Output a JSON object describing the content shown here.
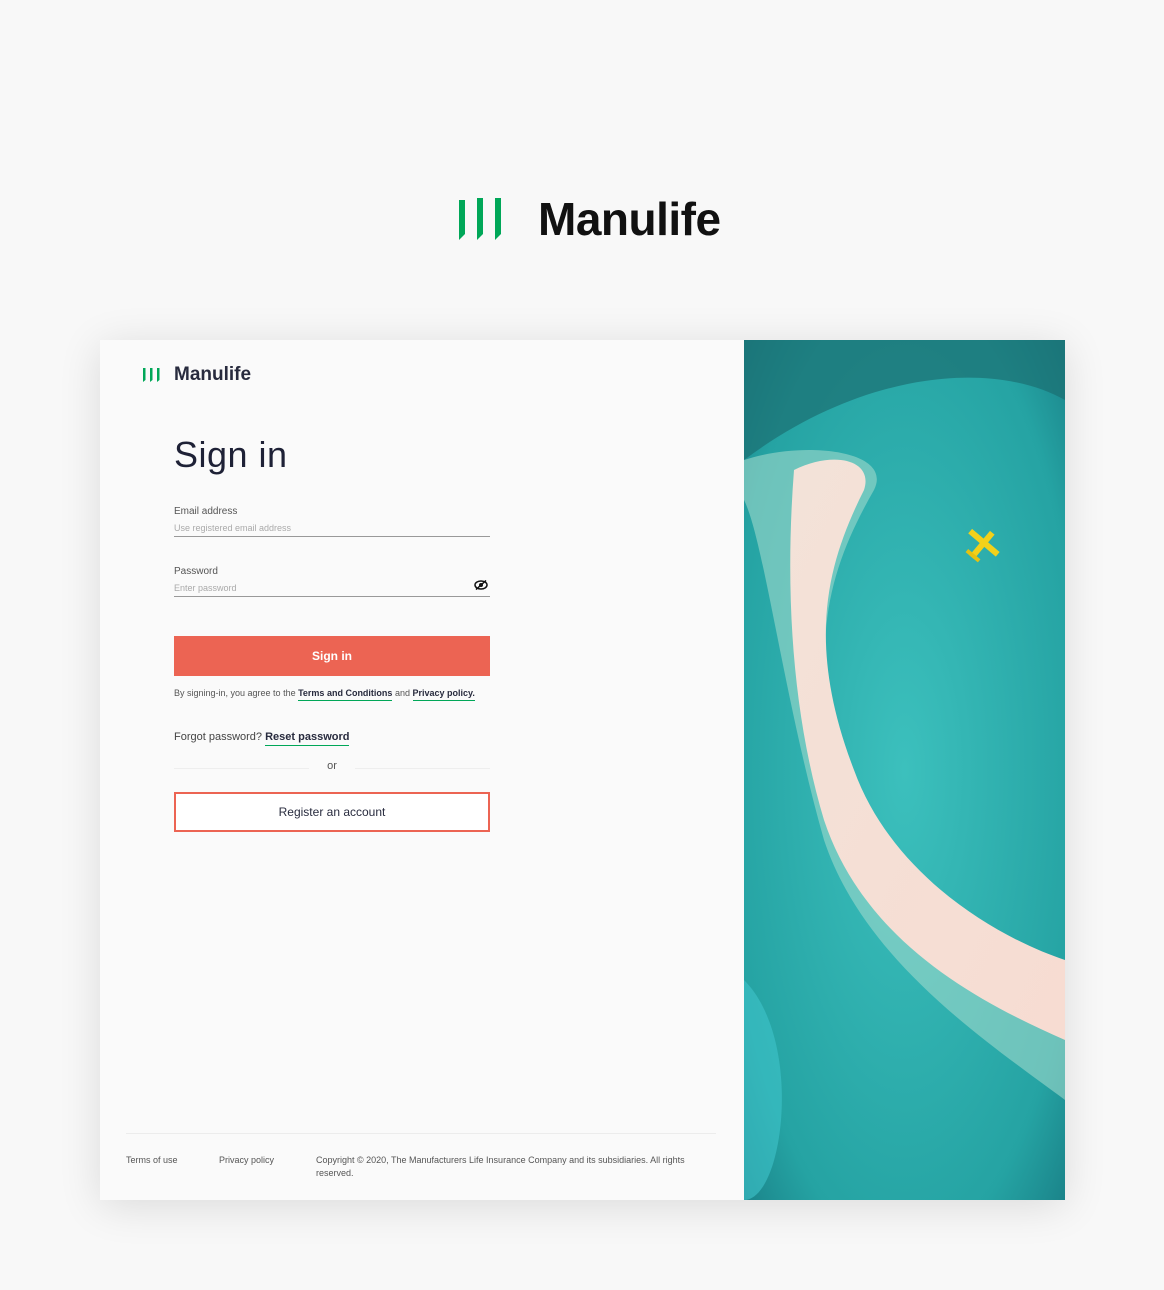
{
  "brand": {
    "name": "Manulife",
    "color": "#00a758",
    "accent": "#ec6453"
  },
  "card": {
    "logo_name": "Manulife",
    "title": "Sign in",
    "email": {
      "label": "Email address",
      "placeholder": "Use registered email address",
      "value": ""
    },
    "password": {
      "label": "Password",
      "placeholder": "Enter password",
      "value": "",
      "toggle_icon": "eye-slash-icon"
    },
    "sign_in_label": "Sign in",
    "agree_prefix": "By signing-in, you agree to the",
    "terms_link": "Terms and Conditions",
    "agree_and": "and",
    "privacy_link": "Privacy policy.",
    "forgot_text": "Forgot password?",
    "reset_link": "Reset password",
    "or_label": "or",
    "register_label": "Register an account"
  },
  "footer": {
    "terms": "Terms of use",
    "privacy": "Privacy policy",
    "copyright": "Copyright © 2020, The Manufacturers Life Insurance Company and its subsidiaries. All rights reserved."
  }
}
